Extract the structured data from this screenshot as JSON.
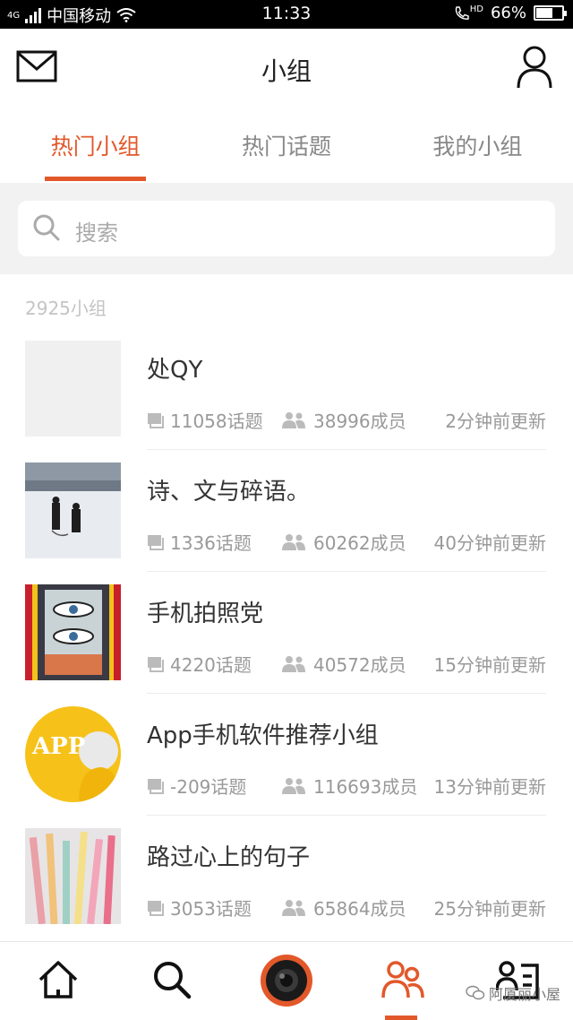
{
  "status_bar": {
    "network": "4G",
    "carrier": "中国移动",
    "time": "11:33",
    "hd": "HD",
    "battery": "66%",
    "battery_level": 0.66
  },
  "header": {
    "title": "小组",
    "icons": {
      "left": "mail-icon",
      "right": "user-icon"
    }
  },
  "tabs": [
    {
      "label": "热门小组",
      "active": true
    },
    {
      "label": "热门话题",
      "active": false
    },
    {
      "label": "我的小组",
      "active": false
    }
  ],
  "search": {
    "placeholder": "搜索"
  },
  "count_label": "2925小组",
  "groups": [
    {
      "name": "处QY",
      "topics": "11058话题",
      "members": "38996成员",
      "updated": "2分钟前更新"
    },
    {
      "name": "诗、文与碎语。",
      "topics": "1336话题",
      "members": "60262成员",
      "updated": "40分钟前更新"
    },
    {
      "name": "手机拍照党",
      "topics": "4220话题",
      "members": "40572成员",
      "updated": "15分钟前更新"
    },
    {
      "name": "App手机软件推荐小组",
      "topics": "-209话题",
      "members": "116693成员",
      "updated": "13分钟前更新",
      "thumb_text": "APP"
    },
    {
      "name": "路过心上的句子",
      "topics": "3053话题",
      "members": "65864成员",
      "updated": "25分钟前更新"
    }
  ],
  "bottom_nav": [
    {
      "icon": "home-icon",
      "active": false
    },
    {
      "icon": "search-icon",
      "active": false
    },
    {
      "icon": "camera-icon",
      "active": false
    },
    {
      "icon": "groups-icon",
      "active": true
    },
    {
      "icon": "profile-list-icon",
      "active": false
    }
  ],
  "watermark": "阿厦丽小屋",
  "colors": {
    "accent": "#e2582a",
    "text": "#333333",
    "muted": "#999999",
    "background": "#f2f2f2"
  }
}
